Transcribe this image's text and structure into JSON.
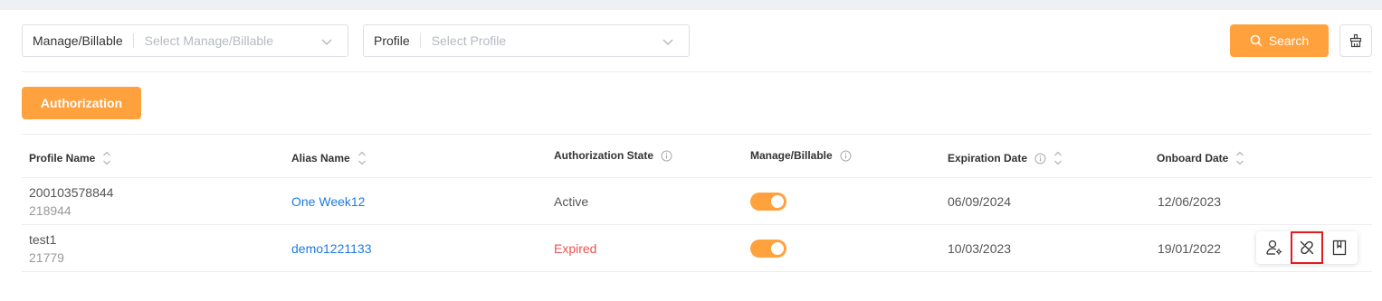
{
  "filters": {
    "manage": {
      "label": "Manage/Billable",
      "placeholder": "Select Manage/Billable"
    },
    "profile": {
      "label": "Profile",
      "placeholder": "Select Profile"
    }
  },
  "search_label": "Search",
  "authorization_label": "Authorization",
  "columns": {
    "profile_name": "Profile Name",
    "alias_name": "Alias Name",
    "authorization_state": "Authorization State",
    "manage_billable": "Manage/Billable",
    "expiration_date": "Expiration Date",
    "onboard_date": "Onboard Date"
  },
  "rows": [
    {
      "profile_name": "200103578844",
      "profile_id": "218944",
      "alias": "One Week12",
      "state": "Active",
      "manage_billable": true,
      "expiration": "06/09/2024",
      "onboard": "12/06/2023"
    },
    {
      "profile_name": "test1",
      "profile_id": "21779",
      "alias": "demo1221133",
      "state": "Expired",
      "manage_billable": true,
      "expiration": "10/03/2023",
      "onboard": "19/01/2022"
    }
  ],
  "row_actions": [
    "user-settings-icon",
    "unlink-icon",
    "bookmark-icon"
  ],
  "colors": {
    "accent": "#ffa13d",
    "link": "#1f7ae0",
    "expired": "#f05050",
    "highlight": "#e11d1d"
  }
}
